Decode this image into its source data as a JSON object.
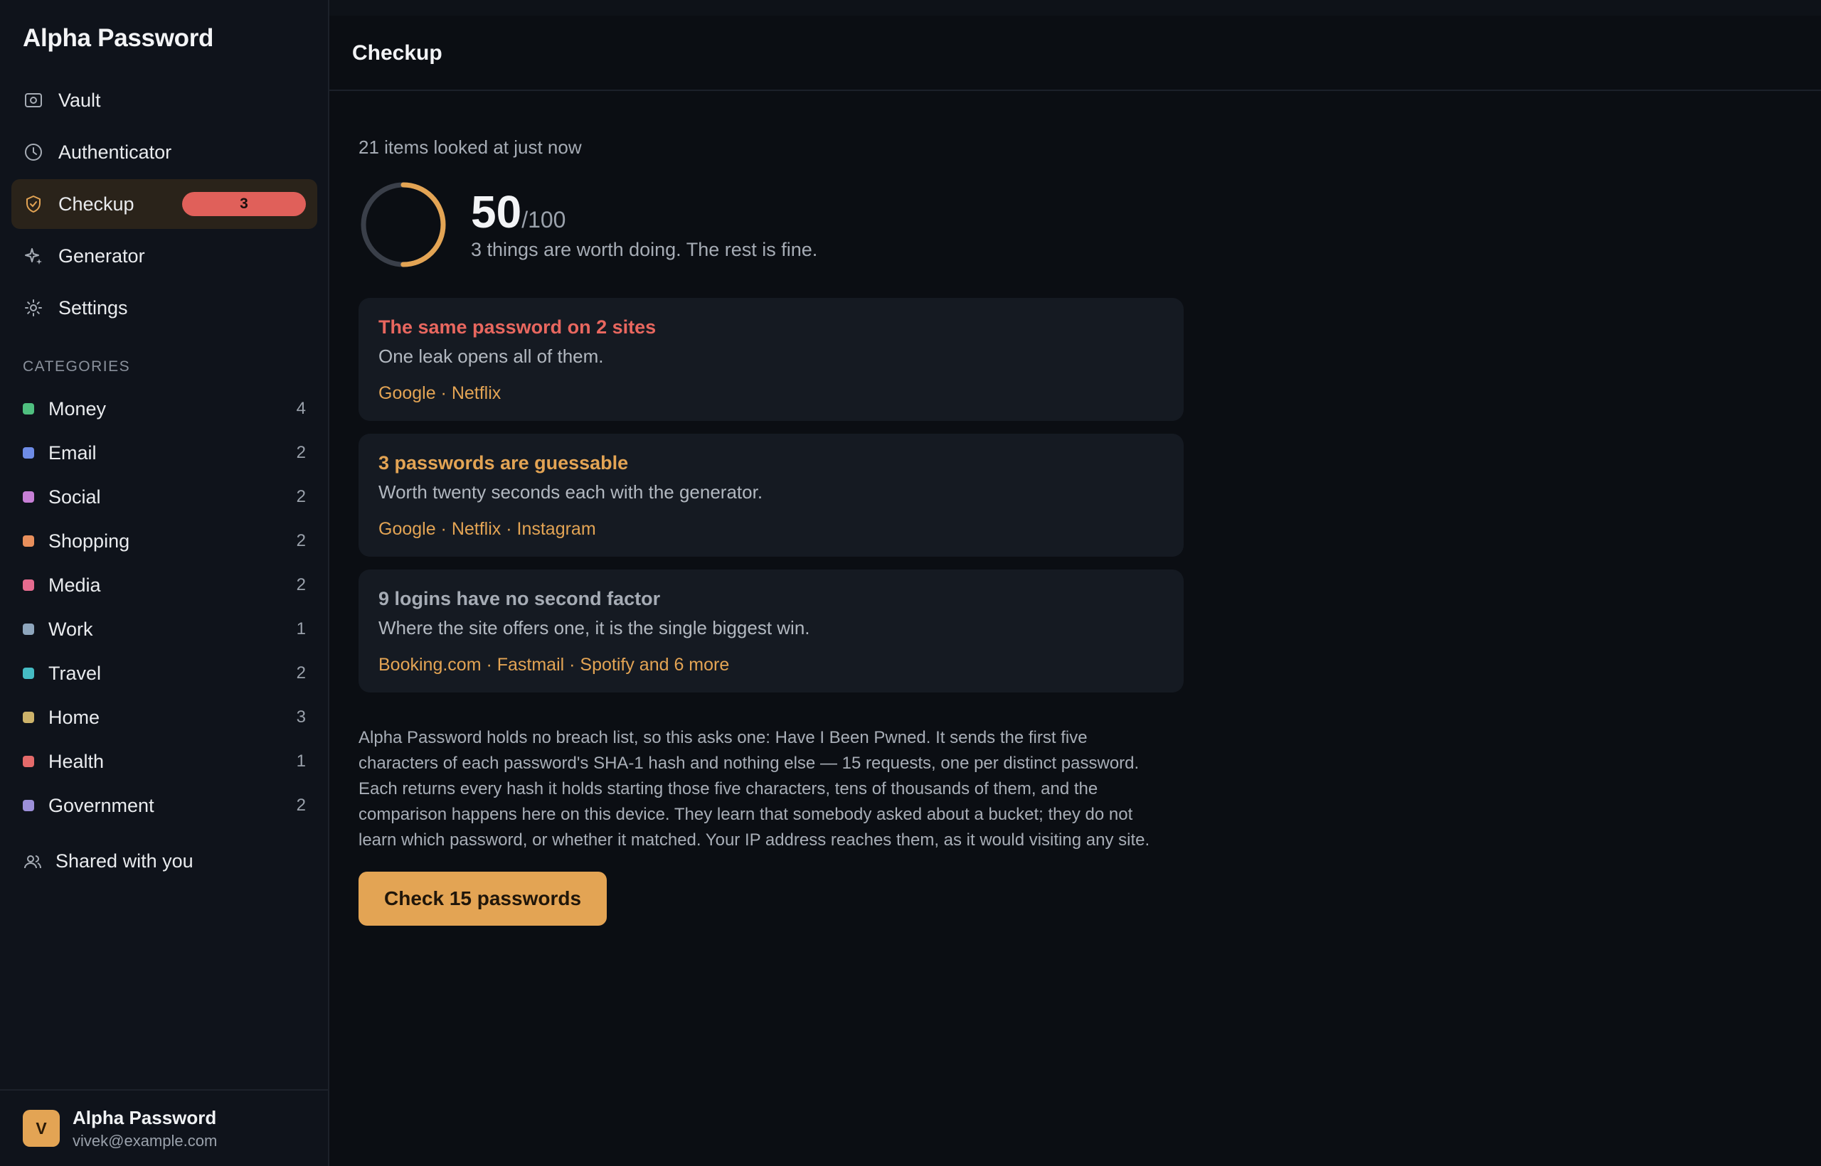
{
  "app": {
    "title": "Alpha Password"
  },
  "nav": {
    "items": [
      {
        "label": "Vault",
        "icon": "vault-icon"
      },
      {
        "label": "Authenticator",
        "icon": "clock-icon"
      },
      {
        "label": "Checkup",
        "icon": "shield-check-icon",
        "badge": "3"
      },
      {
        "label": "Generator",
        "icon": "sparkle-icon"
      },
      {
        "label": "Settings",
        "icon": "gear-icon"
      }
    ]
  },
  "categories": {
    "heading": "CATEGORIES",
    "items": [
      {
        "label": "Money",
        "count": "4",
        "color": "#4fbf7f"
      },
      {
        "label": "Email",
        "count": "2",
        "color": "#6e8ce6"
      },
      {
        "label": "Social",
        "count": "2",
        "color": "#c77fd6"
      },
      {
        "label": "Shopping",
        "count": "2",
        "color": "#e88f5c"
      },
      {
        "label": "Media",
        "count": "2",
        "color": "#e56b8f"
      },
      {
        "label": "Work",
        "count": "1",
        "color": "#8ea6bd"
      },
      {
        "label": "Travel",
        "count": "2",
        "color": "#45bcc4"
      },
      {
        "label": "Home",
        "count": "3",
        "color": "#cdb36a"
      },
      {
        "label": "Health",
        "count": "1",
        "color": "#e46a6a"
      },
      {
        "label": "Government",
        "count": "2",
        "color": "#9c8fd9"
      }
    ]
  },
  "shared": {
    "label": "Shared with you"
  },
  "account": {
    "initial": "V",
    "name": "Alpha Password",
    "email": "vivek@example.com"
  },
  "page": {
    "title": "Checkup"
  },
  "checkup": {
    "looked": "21 items looked at just now",
    "score": "50",
    "score_max": "/100",
    "score_fraction": 0.5,
    "summary": "3 things are worth doing. The rest is fine.",
    "cards": [
      {
        "title": "The same password on 2 sites",
        "title_color": "#e8675f",
        "desc": "One leak opens all of them.",
        "links": "Google · Netflix"
      },
      {
        "title": "3 passwords are guessable",
        "title_color": "#e3a454",
        "desc": "Worth twenty seconds each with the generator.",
        "links": "Google · Netflix · Instagram"
      },
      {
        "title": "9 logins have no second factor",
        "title_color": "#a6acb5",
        "desc": "Where the site offers one, it is the single biggest win.",
        "links": "Booking.com · Fastmail · Spotify and 6 more"
      }
    ],
    "explanation": "Alpha Password holds no breach list, so this asks one: Have I Been Pwned. It sends the first five characters of each password's SHA-1 hash and nothing else — 15 requests, one per distinct password. Each returns every hash it holds starting those five characters, tens of thousands of them, and the comparison happens here on this device. They learn that somebody asked about a bucket; they do not learn which password, or whether it matched. Your IP address reaches them, as it would visiting any site.",
    "button": "Check 15 passwords"
  },
  "colors": {
    "accent": "#e3a454",
    "danger": "#e0605a",
    "sidebar_bg": "#0f131b",
    "card_bg": "#151a22"
  }
}
